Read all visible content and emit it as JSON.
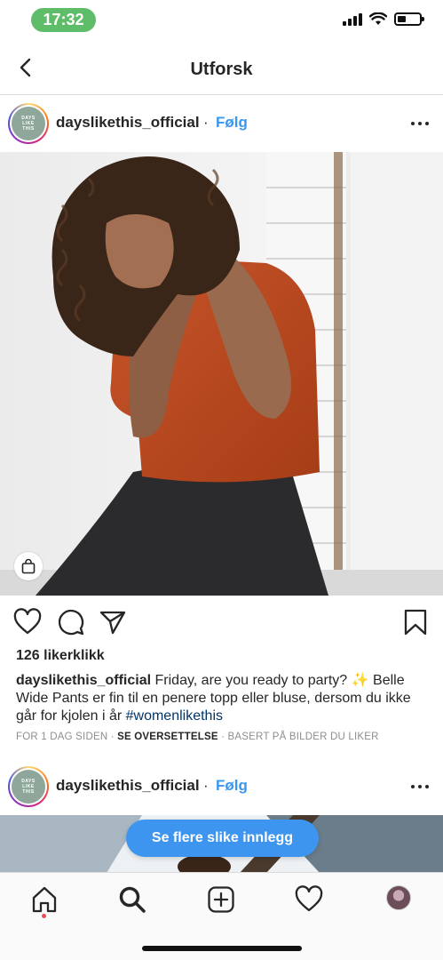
{
  "status_bar": {
    "time": "17:32"
  },
  "nav": {
    "title": "Utforsk"
  },
  "post1": {
    "username": "dayslikethis_official",
    "separator": "·",
    "follow_label": "Følg",
    "avatar_text": "DAYS LIKE THIS",
    "likes": "126 likerklikk",
    "caption_user": "dayslikethis_official",
    "caption_text": " Friday, are you ready to party? ✨ Belle Wide Pants er fin til en penere topp eller bluse, dersom du ikke går for kjolen i år ",
    "caption_hashtag": "#womenlikethis",
    "time_ago": "FOR 1 DAG SIDEN",
    "dot1": " · ",
    "translate": "SE OVERSETTELSE",
    "dot2": " · ",
    "based_on": "BASERT PÅ BILDER DU LIKER"
  },
  "post2": {
    "username": "dayslikethis_official",
    "separator": "·",
    "follow_label": "Følg",
    "avatar_text": "DAYS LIKE THIS"
  },
  "see_more_button": "Se flere slike innlegg",
  "colors": {
    "accent": "#3897f0",
    "button_blue": "#3d95ef",
    "time_pill": "#5fbd6a",
    "notification_dot": "#ed4956",
    "shirt": "#b8461e"
  },
  "icons": {
    "nav_back": "chevron-left-icon",
    "post_menu": "more-horizontal-icon",
    "shopping": "shopping-bag-icon",
    "actions": [
      "heart-icon",
      "comment-icon",
      "share-icon",
      "bookmark-icon"
    ],
    "tabs": [
      "home-icon",
      "search-icon",
      "add-post-icon",
      "activity-heart-icon",
      "profile-avatar"
    ]
  }
}
